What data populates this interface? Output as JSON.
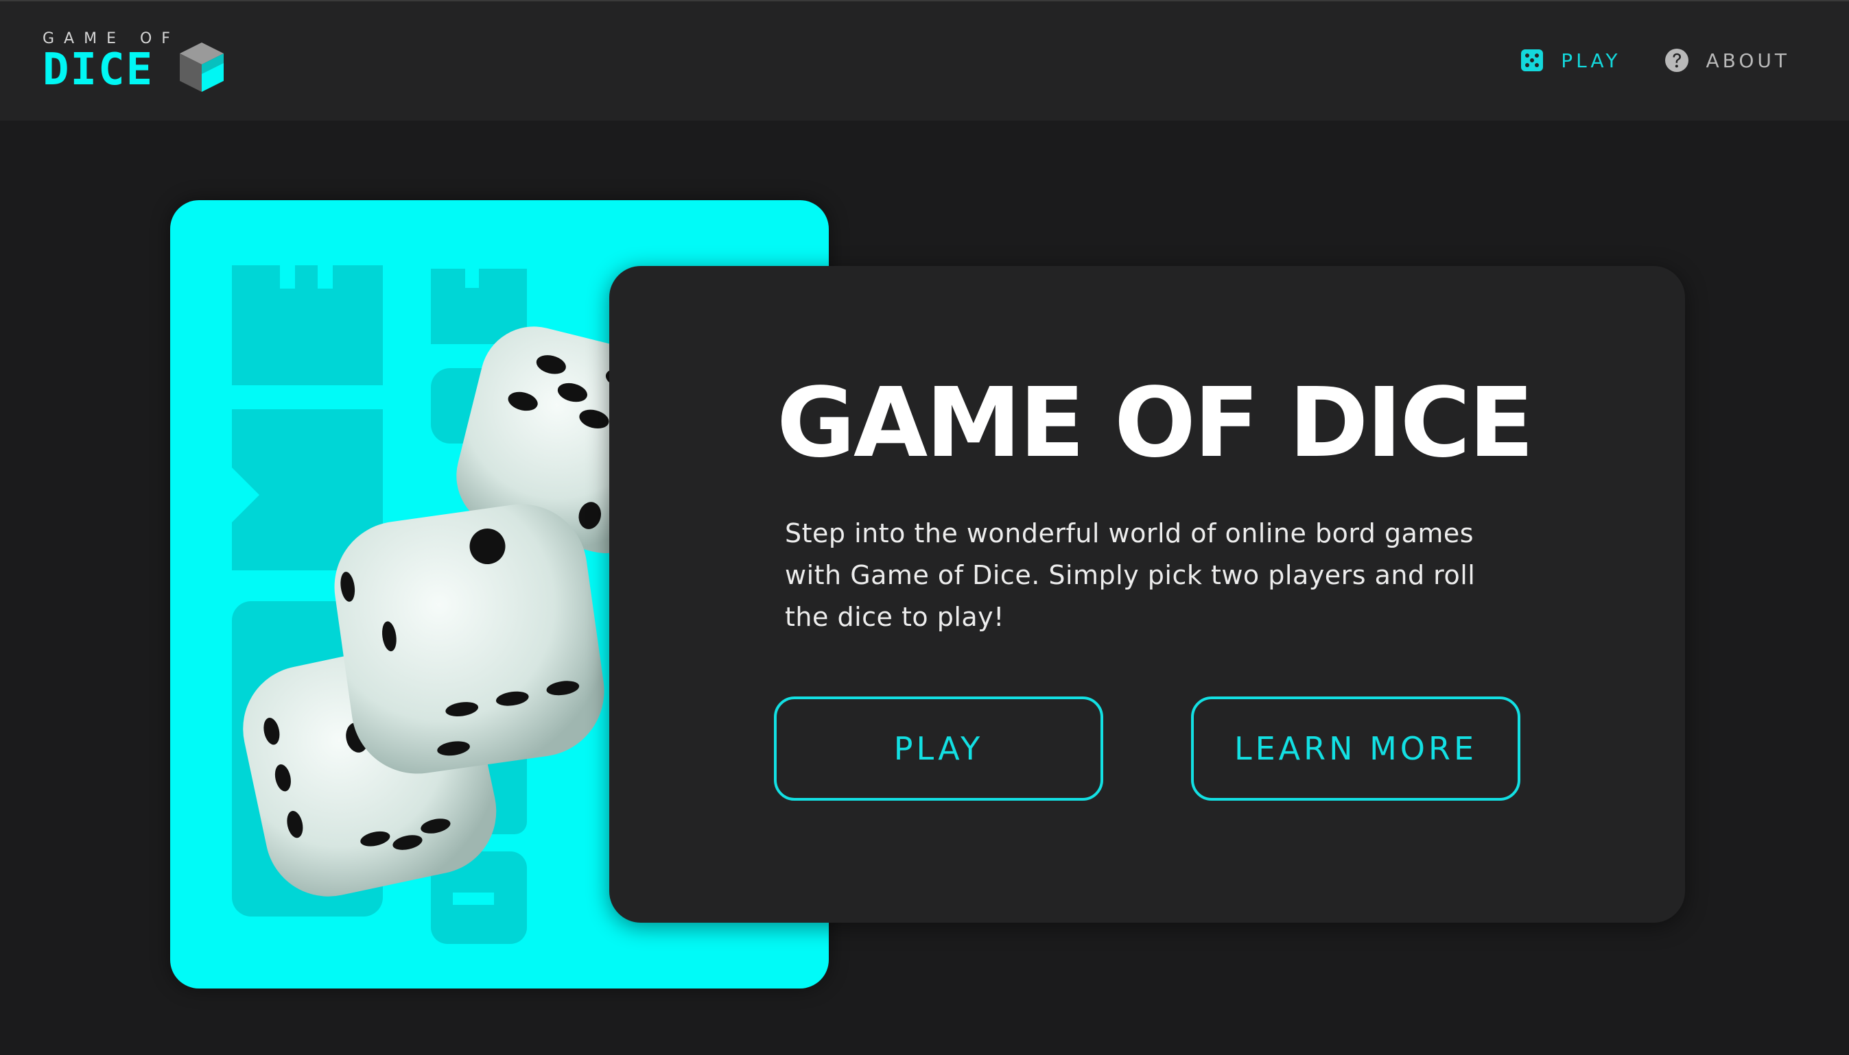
{
  "header": {
    "logo_small": "GAME OF",
    "logo_big": "DICE",
    "nav": [
      {
        "label": "PLAY",
        "icon": "dice-icon",
        "active": true
      },
      {
        "label": "ABOUT",
        "icon": "question-circle-icon",
        "active": false
      }
    ]
  },
  "hero": {
    "title": "GAME OF DICE",
    "description": "Step into the wonderful world of online bord games with Game of Dice. Simply pick two players and roll the dice to play!",
    "buttons": {
      "play": "PLAY",
      "learn_more": "LEARN MORE"
    }
  },
  "colors": {
    "accent": "#00f7f4",
    "accent_text": "#13e0e3",
    "background": "#1b1b1c",
    "card": "#232324"
  }
}
